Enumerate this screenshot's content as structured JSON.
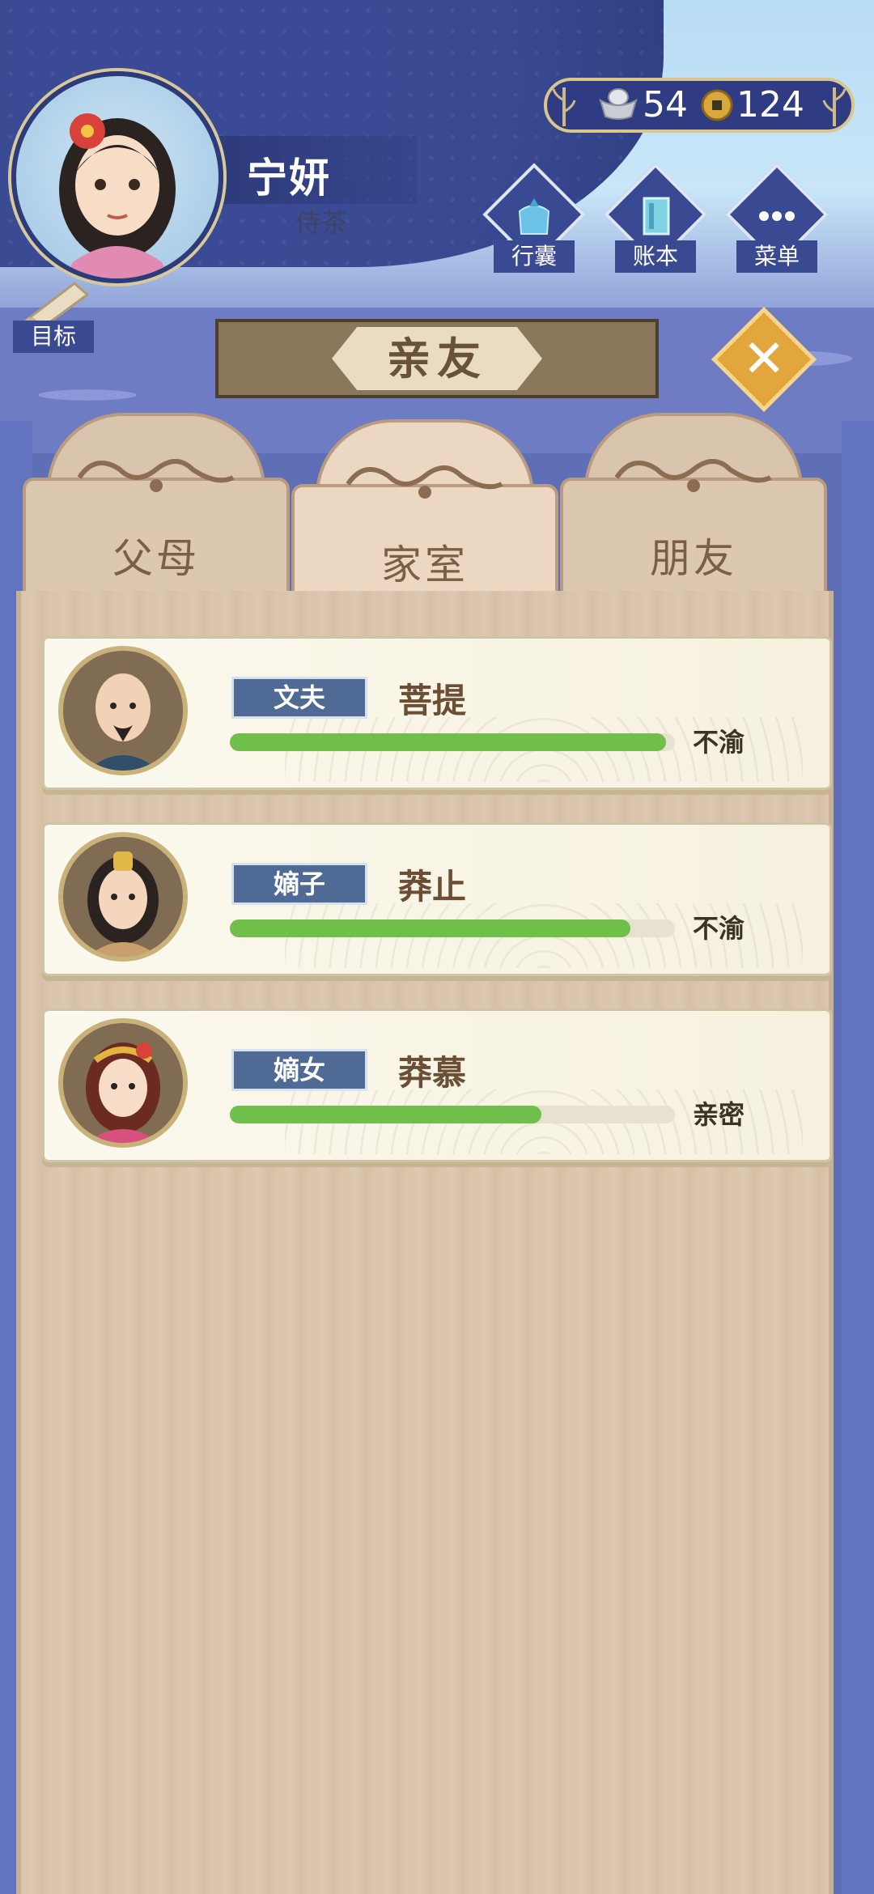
{
  "player": {
    "name": "宁妍",
    "title": "侍茶"
  },
  "currency": {
    "silver": "54",
    "coins": "124"
  },
  "menu": [
    {
      "label": "行囊",
      "icon": "bag-icon"
    },
    {
      "label": "账本",
      "icon": "ledger-icon"
    },
    {
      "label": "菜单",
      "icon": "more-icon"
    }
  ],
  "goal_label": "目标",
  "panel_title": "亲友",
  "tabs": [
    {
      "label": "父母",
      "active": false
    },
    {
      "label": "家室",
      "active": true
    },
    {
      "label": "朋友",
      "active": false
    }
  ],
  "relations": [
    {
      "role": "文夫",
      "name": "菩提",
      "affection": 0.98,
      "status": "不渝"
    },
    {
      "role": "嫡子",
      "name": "莽止",
      "affection": 0.9,
      "status": "不渝"
    },
    {
      "role": "嫡女",
      "name": "莽慕",
      "affection": 0.7,
      "status": "亲密"
    }
  ],
  "colors": {
    "navy": "#3a4a92",
    "affection_bar": "#6fbf4a",
    "role_tag": "#4e6a95",
    "close_button": "#e3a63d"
  }
}
